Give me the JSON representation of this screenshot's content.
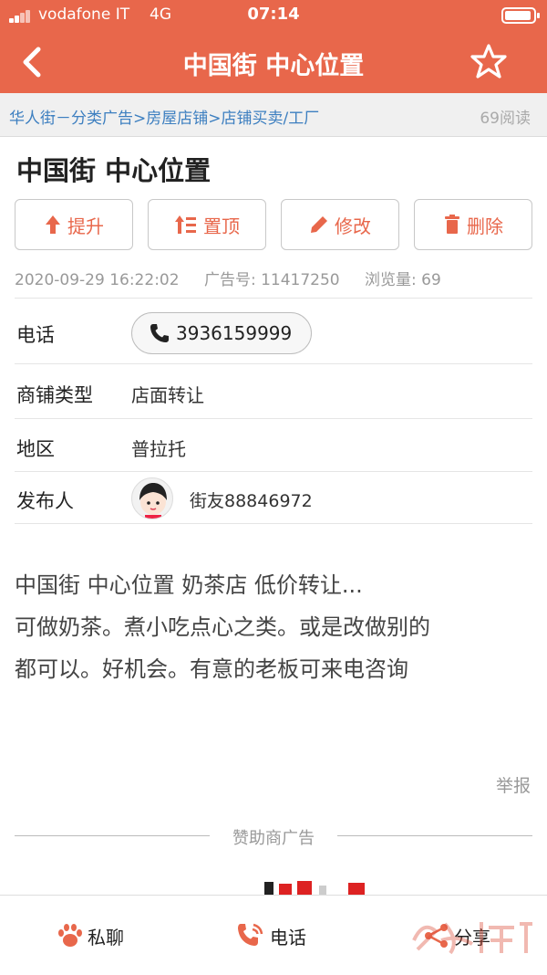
{
  "status_bar": {
    "carrier": "vodafone IT",
    "network": "4G",
    "time": "07:14"
  },
  "nav": {
    "title": "中国街  中心位置"
  },
  "breadcrumb": {
    "path": "华人街－分类广告>房屋店铺>店铺买卖/工厂",
    "read_count": "69阅读"
  },
  "post": {
    "title": "中国街  中心位置",
    "actions": [
      {
        "label": "提升",
        "icon": "arrow-up-icon"
      },
      {
        "label": "置顶",
        "icon": "pin-top-icon"
      },
      {
        "label": "修改",
        "icon": "pencil-icon"
      },
      {
        "label": "删除",
        "icon": "trash-icon"
      }
    ],
    "meta": {
      "date": "2020-09-29 16:22:02",
      "ad_number": "广告号: 11417250",
      "views": "浏览量: 69"
    },
    "fields": {
      "phone_label": "电话",
      "phone_value": "3936159999",
      "shop_type_label": "商铺类型",
      "shop_type_value": "店面转让",
      "region_label": "地区",
      "region_value": "普拉托",
      "publisher_label": "发布人",
      "publisher_value": "街友88846972"
    },
    "description_lines": [
      "中国街  中心位置 奶茶店 低价转让...",
      "可做奶茶。煮小吃点心之类。或是改做别的",
      "都可以。好机会。有意的老板可来电咨询"
    ],
    "report": "举报"
  },
  "sponsor_label": "赞助商广告",
  "tabbar": {
    "chat": "私聊",
    "call": "电话",
    "share": "分享"
  },
  "colors": {
    "brand": "#e8674b",
    "link": "#3d7fc0",
    "muted": "#999999"
  }
}
